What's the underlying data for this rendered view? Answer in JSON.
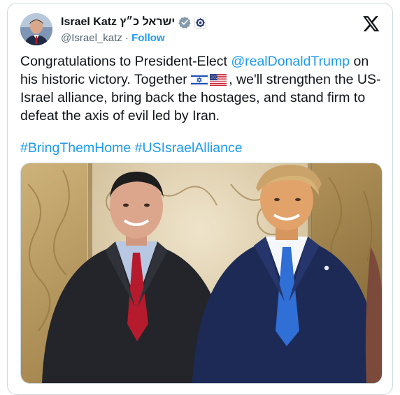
{
  "tweet": {
    "display_name": "Israel Katz ישראל כ״ץ",
    "handle": "@Israel_katz",
    "separator": "·",
    "follow_label": "Follow",
    "text_before_mention": "Congratulations to President-Elect ",
    "mention": "@realDonaldTrump",
    "text_after_mention": " on his historic victory. Together ",
    "text_after_flags": ", we'll strengthen the US-Israel alliance, bring back the hostages, and stand firm to defeat the axis of evil led by Iran.",
    "hashtags": [
      "#BringThemHome",
      "#USIsraelAlliance"
    ]
  },
  "icons": {
    "verified": "verified-badge-icon",
    "org_badge": "government-affiliation-icon",
    "x_logo": "x-logo-icon",
    "flags": [
      "israel-flag-icon",
      "usa-flag-icon"
    ]
  },
  "colors": {
    "accent": "#1d9bf0",
    "text": "#0f1419",
    "muted": "#536471",
    "border": "#cfd9de"
  },
  "media": {
    "type": "photo",
    "depicts": [
      "man-in-red-tie",
      "man-in-blue-tie"
    ]
  }
}
